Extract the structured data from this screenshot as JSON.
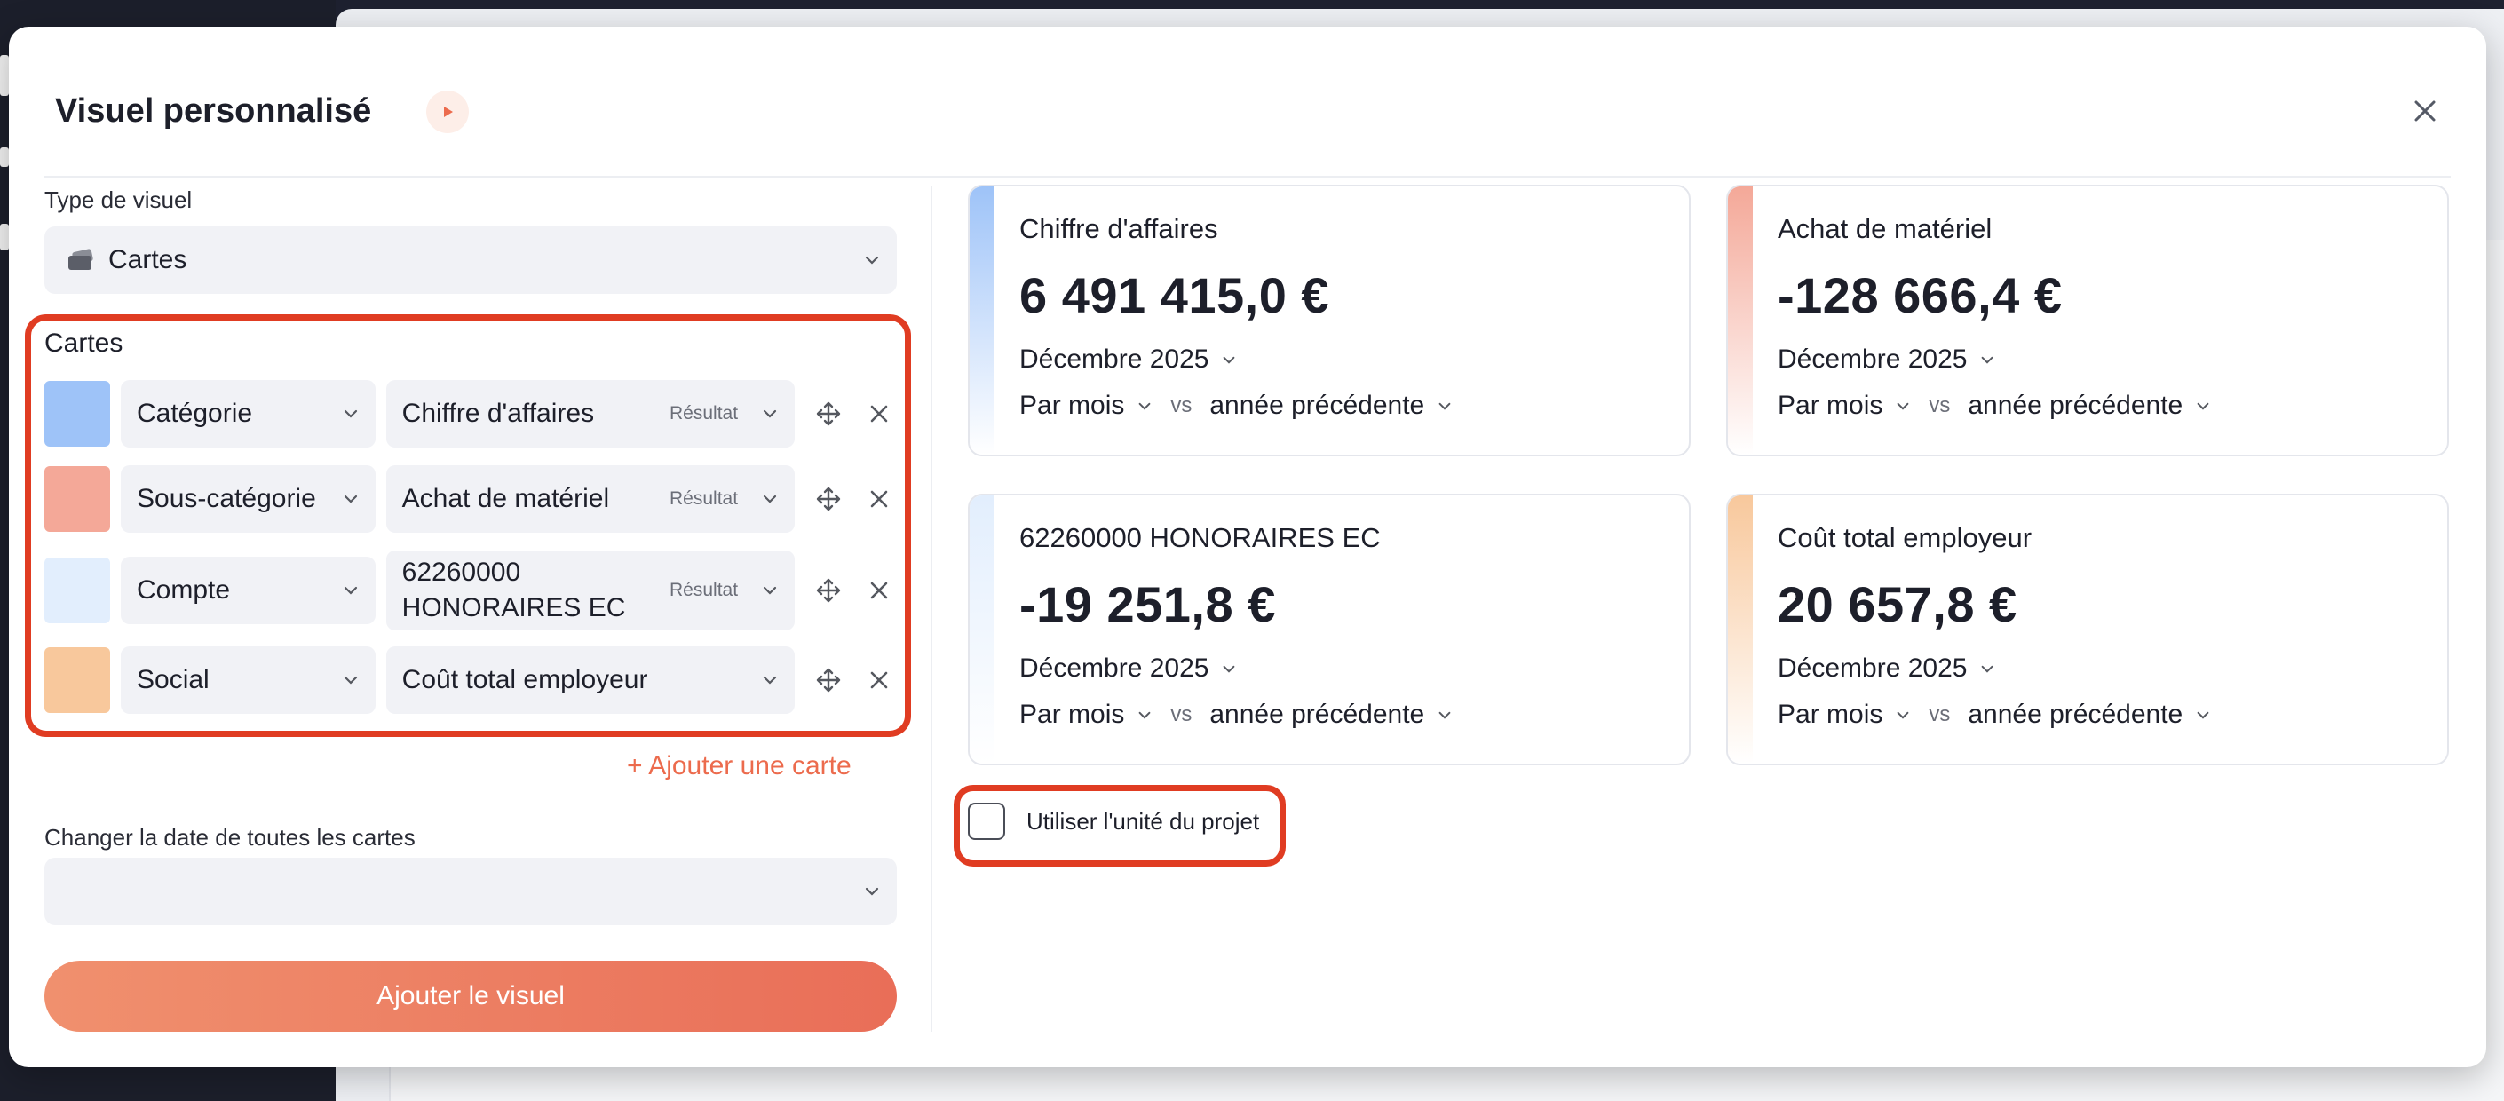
{
  "modal": {
    "title": "Visuel personnalisé"
  },
  "form": {
    "type_label": "Type de visuel",
    "type_value": "Cartes",
    "cards_label": "Cartes",
    "rows": [
      {
        "color": "#9ec3f8",
        "category": "Catégorie",
        "item": "Chiffre d'affaires",
        "tag": "Résultat"
      },
      {
        "color": "#f4a898",
        "category": "Sous-catégorie",
        "item": "Achat de matériel",
        "tag": "Résultat"
      },
      {
        "color": "#e2eefd",
        "category": "Compte",
        "item": "62260000 HONORAIRES EC",
        "tag": "Résultat"
      },
      {
        "color": "#f8c89c",
        "category": "Social",
        "item": "Coût total employeur",
        "tag": ""
      }
    ],
    "add_card": "+ Ajouter une carte",
    "date_label": "Changer la date de toutes les cartes",
    "date_value": "",
    "submit": "Ajouter le visuel"
  },
  "preview": {
    "cards": [
      {
        "title": "Chiffre d'affaires",
        "value": "6 491 415,0 €",
        "date": "Décembre 2025",
        "period": "Par mois",
        "vs": "vs",
        "compare": "année précédente",
        "accent": "#9ec3f8"
      },
      {
        "title": "Achat de matériel",
        "value": "-128 666,4 €",
        "date": "Décembre 2025",
        "period": "Par mois",
        "vs": "vs",
        "compare": "année précédente",
        "accent": "#f4a898"
      },
      {
        "title": "62260000 HONORAIRES EC",
        "value": "-19 251,8 €",
        "date": "Décembre 2025",
        "period": "Par mois",
        "vs": "vs",
        "compare": "année précédente",
        "accent": "#e2eefd"
      },
      {
        "title": "Coût total employeur",
        "value": "20 657,8 €",
        "date": "Décembre 2025",
        "period": "Par mois",
        "vs": "vs",
        "compare": "année précédente",
        "accent": "#f8c89c"
      }
    ],
    "unit_checkbox_label": "Utiliser l'unité du projet",
    "unit_checked": false
  },
  "colors": {
    "accent_orange": "#ec6b4d",
    "highlight_red": "#e03c22"
  }
}
